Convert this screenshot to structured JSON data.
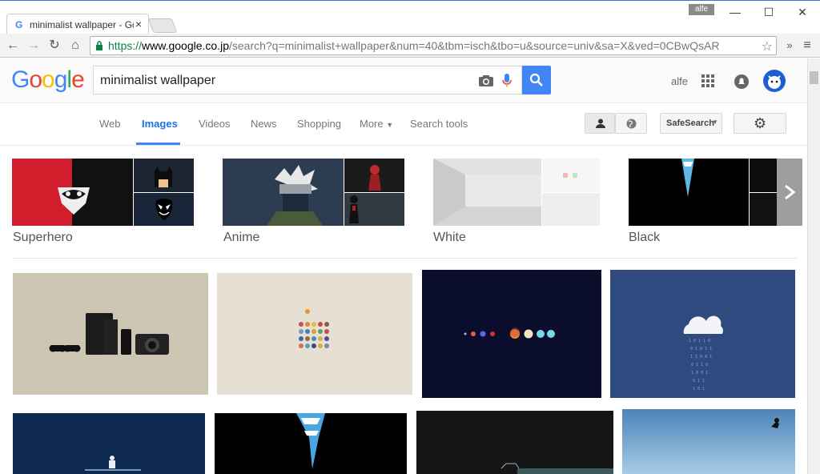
{
  "browser": {
    "tab_title": "minimalist wallpaper - Go",
    "tab_favicon": "G",
    "tab_close": "×",
    "user_chip": "alfe",
    "url_https": "https://",
    "url_host": "www.google.co.jp",
    "url_path": "/search?q=minimalist+wallpaper&num=40&tbm=isch&tbo=u&source=univ&sa=X&ved=0CBwQsAR",
    "extensions": "»"
  },
  "google": {
    "search_query": "minimalist wallpaper",
    "user_name": "alfe"
  },
  "nav_tabs": [
    {
      "label": "Web"
    },
    {
      "label": "Images"
    },
    {
      "label": "Videos"
    },
    {
      "label": "News"
    },
    {
      "label": "Shopping"
    },
    {
      "label": "More"
    },
    {
      "label": "Search tools"
    }
  ],
  "safesearch_label": "SafeSearch",
  "related": [
    {
      "label": "Superhero"
    },
    {
      "label": "Anime"
    },
    {
      "label": "White"
    },
    {
      "label": "Black"
    }
  ],
  "colors": {
    "accent": "#4285f4",
    "tile_beige": "#cdc6b3",
    "tile_cream": "#e6dfd4",
    "tile_navy": "#0b0d2c",
    "tile_slate": "#2f4a7e",
    "tile_darkblue": "#0f2a4f"
  }
}
